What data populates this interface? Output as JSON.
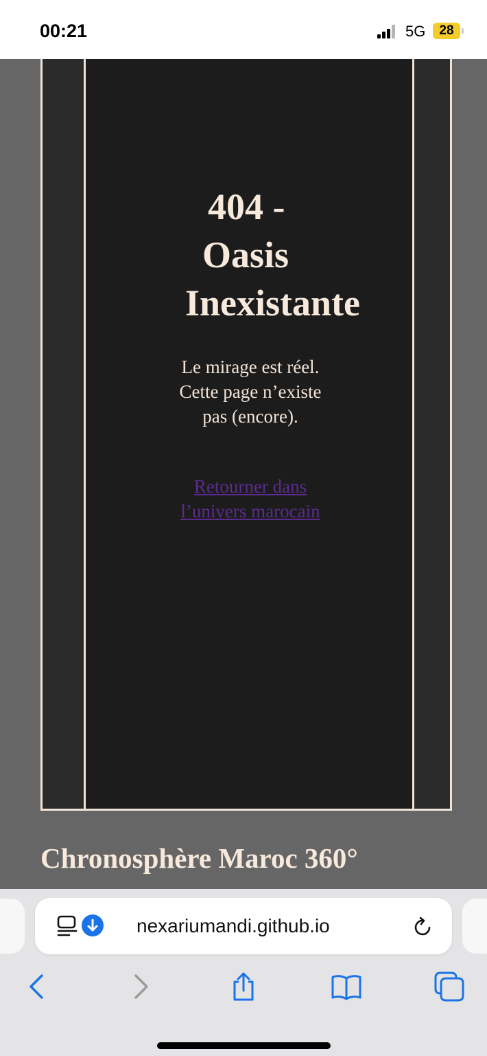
{
  "status_bar": {
    "time": "00:21",
    "network": "5G",
    "battery": "28"
  },
  "page": {
    "error_title_line1": "404 -",
    "error_title_line2": "Oasis",
    "error_title_line3": "Inexistante",
    "message": "Le mirage est réel. Cette page n’existe pas (encore).",
    "home_link": "Retourner dans l’univers marocain",
    "footer_title": "Chronosphère Maroc 360°"
  },
  "browser": {
    "url": "nexariumandi.github.io",
    "icons": {
      "reader": "reader-mode-icon",
      "download": "download-icon",
      "reload": "reload-icon",
      "back": "back-icon",
      "forward": "forward-icon",
      "share": "share-icon",
      "bookmarks": "bookmarks-icon",
      "tabs": "tabs-icon"
    }
  },
  "colors": {
    "page_background": "#666666",
    "frame_border": "#f2e3d7",
    "panel_background": "#1c1c1c",
    "title_text": "#f7e9dc",
    "link": "#5b2b8f",
    "ios_blue": "#1a73e8"
  }
}
